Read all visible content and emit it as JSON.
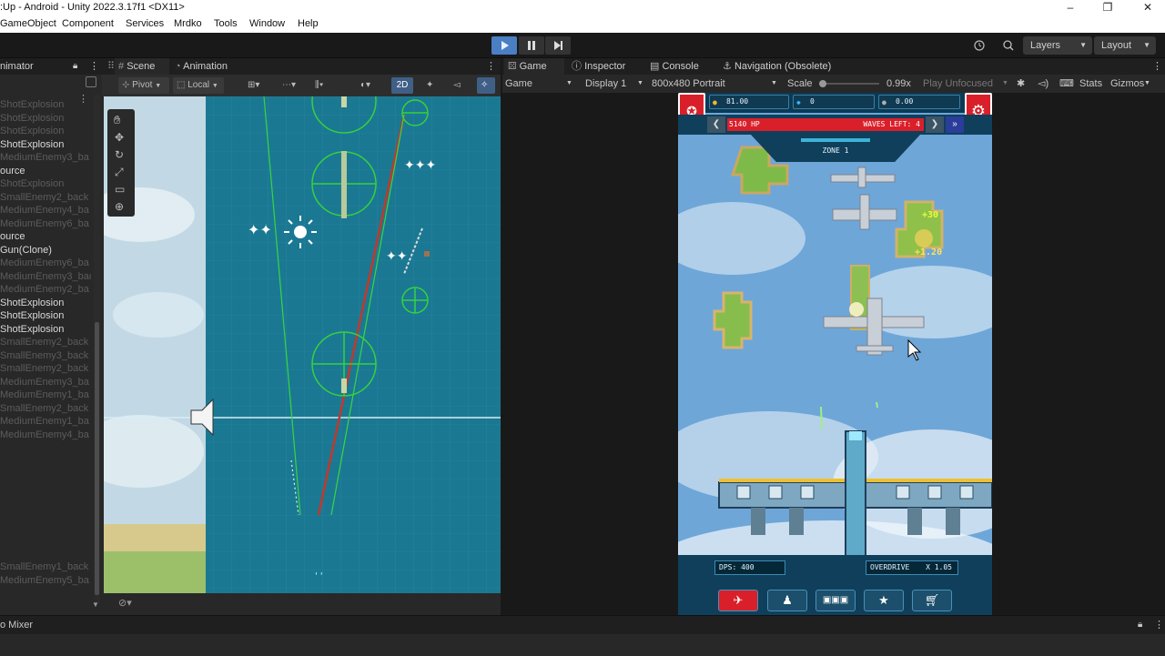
{
  "window": {
    "title": ":Up - Android - Unity 2022.3.17f1 <DX11>",
    "minimize": "–",
    "maximize": "❐",
    "close": "✕"
  },
  "menu": [
    "GameObject",
    "Component",
    "Services",
    "Mrdko",
    "Tools",
    "Window",
    "Help"
  ],
  "toolbar": {
    "play_icon": "play-icon",
    "layers_label": "Layers",
    "layout_label": "Layout"
  },
  "hierarchy": {
    "tab_label": "nimator",
    "rows": [
      {
        "text": "ShotExplosion",
        "style": "g"
      },
      {
        "text": "ShotExplosion",
        "style": "g"
      },
      {
        "text": "ShotExplosion",
        "style": "g"
      },
      {
        "text": "ShotExplosion",
        "style": "w"
      },
      {
        "text": "MediumEnemy3_ba",
        "style": "g"
      },
      {
        "text": "ource",
        "style": "w"
      },
      {
        "text": "ShotExplosion",
        "style": "g"
      },
      {
        "text": "SmallEnemy2_back",
        "style": "g"
      },
      {
        "text": "MediumEnemy4_ba",
        "style": "g"
      },
      {
        "text": "MediumEnemy6_ba",
        "style": "g"
      },
      {
        "text": "ource",
        "style": "w"
      },
      {
        "text": "Gun(Clone)",
        "style": "w"
      },
      {
        "text": "MediumEnemy6_ba",
        "style": "g"
      },
      {
        "text": "MediumEnemy3_back",
        "style": "g"
      },
      {
        "text": "MediumEnemy2_ba",
        "style": "g"
      },
      {
        "text": "ShotExplosion",
        "style": "w"
      },
      {
        "text": "ShotExplosion",
        "style": "w"
      },
      {
        "text": "ShotExplosion",
        "style": "w"
      },
      {
        "text": "SmallEnemy2_back",
        "style": "g"
      },
      {
        "text": "SmallEnemy3_back",
        "style": "g"
      },
      {
        "text": "SmallEnemy2_back",
        "style": "g"
      },
      {
        "text": "MediumEnemy3_ba",
        "style": "g"
      },
      {
        "text": "MediumEnemy1_ba",
        "style": "g"
      },
      {
        "text": "SmallEnemy2_back",
        "style": "g"
      },
      {
        "text": "MediumEnemy1_ba",
        "style": "g"
      },
      {
        "text": "MediumEnemy4_ba",
        "style": "g"
      }
    ],
    "bottom_rows": [
      {
        "text": "SmallEnemy1_back",
        "style": "g"
      },
      {
        "text": "MediumEnemy5_ba",
        "style": "g"
      }
    ]
  },
  "scene": {
    "tab_scene": "Scene",
    "tab_animation": "Animation",
    "pivot": "Pivot",
    "local": "Local",
    "mode_2d": "2D"
  },
  "game_panel": {
    "tab_game": "Game",
    "tab_inspector": "Inspector",
    "tab_console": "Console",
    "tab_navigation": "Navigation (Obsolete)",
    "view_mode": "Game",
    "display": "Display 1",
    "resolution": "800x480 Portrait",
    "scale_label": "Scale",
    "scale_value": "0.99x",
    "play_unfocused": "Play Unfocused",
    "stats": "Stats",
    "gizmos": "Gizmos"
  },
  "game": {
    "coins": "81.00",
    "gems": "0",
    "bombs": "0.00",
    "hp": "5140 HP",
    "waves": "WAVES LEFT: 4",
    "zone": "ZONE 1",
    "dps": "DPS: 400",
    "overdrive_label": "OVERDRIVE",
    "overdrive_value": "X 1.05",
    "floating_1": "+30",
    "floating_2": "+1.20"
  },
  "bottom_panel": {
    "tab": "o Mixer"
  },
  "colors": {
    "unity_dark": "#191919",
    "panel": "#282828",
    "scene_water": "#1b7893",
    "gizmo_green": "#2fd33a",
    "gizmo_red": "#c0392b",
    "hud_teal": "#0f3f5a",
    "hp_red": "#d9202a",
    "sky": "#6aa3d6"
  }
}
